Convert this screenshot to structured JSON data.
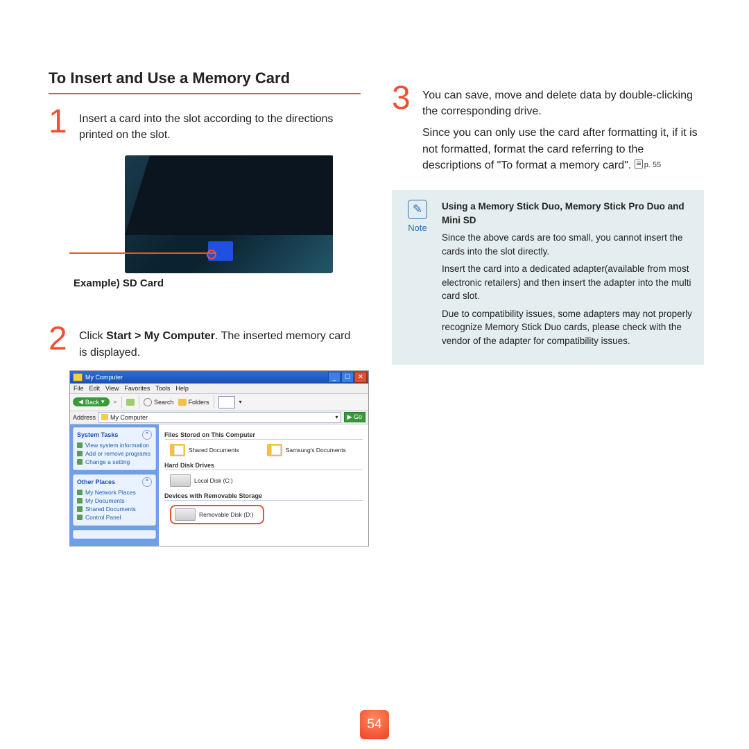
{
  "page": {
    "number": "54",
    "section_title": "To Insert and Use a Memory Card"
  },
  "steps": {
    "s1": {
      "num": "1",
      "text": "Insert a card into the slot according to the directions printed on the slot."
    },
    "s2": {
      "num": "2",
      "pre": "Click ",
      "bold": "Start > My Computer",
      "post": ". The inserted memory card is displayed."
    },
    "s3": {
      "num": "3",
      "line1": "You can save, move and delete data by double-clicking the corresponding drive.",
      "line2_a": "Since you can only use the card after formatting it, if it is not formatted, format the card referring to the descriptions of \"To format a memory card\". ",
      "line2_ref": "p. 55"
    }
  },
  "laptop": {
    "example_label": "Example) SD Card"
  },
  "screenshot": {
    "title": "My Computer",
    "menus": [
      "File",
      "Edit",
      "View",
      "Favorites",
      "Tools",
      "Help"
    ],
    "toolbar": {
      "back": "Back",
      "search": "Search",
      "folders": "Folders"
    },
    "address_label": "Address",
    "address_value": "My Computer",
    "go": "Go",
    "side": {
      "system_tasks": {
        "label": "System Tasks",
        "items": [
          "View system information",
          "Add or remove programs",
          "Change a setting"
        ]
      },
      "other_places": {
        "label": "Other Places",
        "items": [
          "My Network Places",
          "My Documents",
          "Shared Documents",
          "Control Panel"
        ]
      }
    },
    "groups": {
      "g1": {
        "label": "Files Stored on This Computer",
        "items": [
          "Shared Documents",
          "Samsung's Documents"
        ]
      },
      "g2": {
        "label": "Hard Disk Drives",
        "items": [
          "Local Disk (C:)"
        ]
      },
      "g3": {
        "label": "Devices with Removable Storage",
        "items": [
          "Removable Disk (D:)"
        ]
      }
    }
  },
  "note": {
    "label": "Note",
    "heading": "Using a Memory Stick Duo, Memory Stick Pro Duo and Mini SD",
    "p1": "Since the above cards are too small, you cannot insert the cards into the slot directly.",
    "p2": "Insert the card into a dedicated adapter(available from most electronic retailers) and then insert the adapter into the multi card slot.",
    "p3": "Due to compatibility issues, some adapters may not properly recognize Memory Stick Duo cards, please check with the vendor of the adapter for compatibility issues."
  }
}
